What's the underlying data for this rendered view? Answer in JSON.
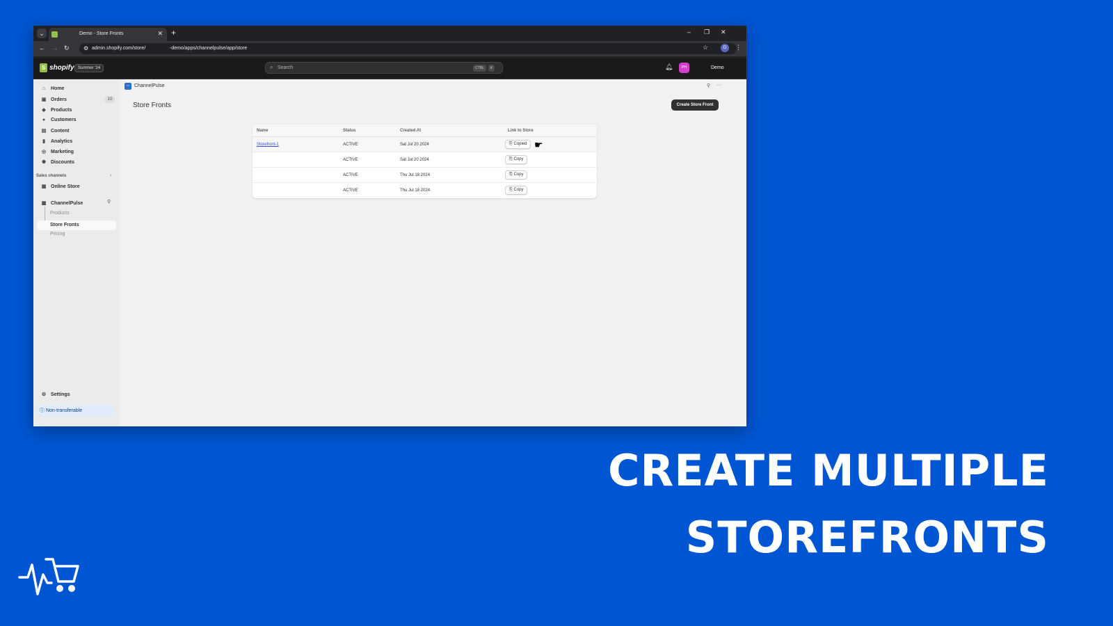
{
  "browser": {
    "tab_title": "Demo - Store Fronts",
    "url_prefix": "admin.shopify.com/store/",
    "url_suffix": "-demo/apps/channelpulse/app/store"
  },
  "shopify": {
    "logo_text": "shopify",
    "edition_badge": "Summer '24",
    "search_placeholder": "Search",
    "kbd_ctrl": "CTRL",
    "kbd_k": "K",
    "avatar_initials": "PH",
    "store_name": "Demo"
  },
  "sidebar": {
    "items": [
      {
        "label": "Home",
        "icon": "home-icon"
      },
      {
        "label": "Orders",
        "icon": "orders-icon",
        "count": "10"
      },
      {
        "label": "Products",
        "icon": "tag-icon"
      },
      {
        "label": "Customers",
        "icon": "person-icon"
      },
      {
        "label": "Content",
        "icon": "content-icon"
      },
      {
        "label": "Analytics",
        "icon": "bar-chart-icon"
      },
      {
        "label": "Marketing",
        "icon": "target-icon"
      },
      {
        "label": "Discounts",
        "icon": "discount-icon"
      }
    ],
    "sales_channels_heading": "Sales channels",
    "online_store": "Online Store",
    "app_name": "ChannelPulse",
    "app_subitems": [
      "Products",
      "Store Fronts",
      "Pricing"
    ],
    "settings": "Settings",
    "non_transferable": "Non-transferable"
  },
  "main": {
    "app_header": "ChannelPulse",
    "page_title": "Store Fronts",
    "create_button": "Create Store Front",
    "columns": [
      "Name",
      "Status",
      "Created At",
      "Link to Store"
    ],
    "rows": [
      {
        "name": "Storefront-1",
        "status": "ACTIVE",
        "created": "Sat Jul 20 2024",
        "action": "Copied"
      },
      {
        "name": "",
        "status": "ACTIVE",
        "created": "Sat Jul 20 2024",
        "action": "Copy"
      },
      {
        "name": "",
        "status": "ACTIVE",
        "created": "Thu Jul 18 2024",
        "action": "Copy"
      },
      {
        "name": "",
        "status": "ACTIVE",
        "created": "Thu Jul 18 2024",
        "action": "Copy"
      }
    ]
  },
  "promo": {
    "line1": "CREATE MULTIPLE",
    "line2": "STOREFRONTS",
    "background_color": "#0056d2"
  }
}
